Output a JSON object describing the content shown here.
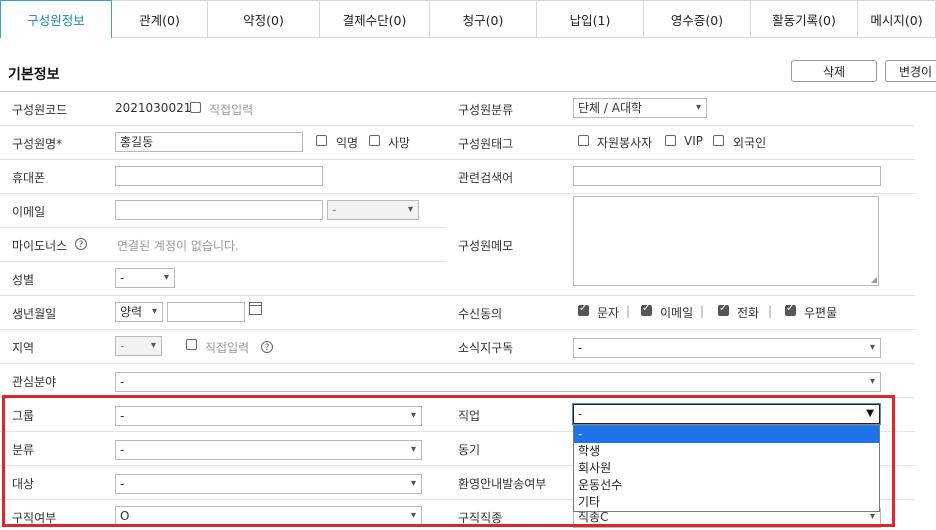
{
  "tabs": [
    {
      "label": "구성원정보",
      "active": true
    },
    {
      "label": "관계(0)"
    },
    {
      "label": "약정(0)"
    },
    {
      "label": "결제수단(0)"
    },
    {
      "label": "청구(0)"
    },
    {
      "label": "납입(1)"
    },
    {
      "label": "영수증(0)"
    },
    {
      "label": "활동기록(0)"
    },
    {
      "label": "메시지(0)"
    }
  ],
  "section_title": "기본정보",
  "buttons": {
    "delete": "삭제",
    "change": "변경이"
  },
  "left": {
    "code_label": "구성원코드",
    "code_value": "2021030021",
    "direct_input": "직접입력",
    "name_label": "구성원명*",
    "name_value": "홍길동",
    "anonymous": "익명",
    "deceased": "사망",
    "phone_label": "휴대폰",
    "email_label": "이메일",
    "email_domain": "-",
    "mind_label": "마이도너스",
    "mind_value": "연결된 계정이 없습니다.",
    "gender_label": "성별",
    "gender_value": "-",
    "birth_label": "생년월일",
    "birth_calendar": "양력",
    "region_label": "지역",
    "region_value": "-",
    "region_direct": "직접입력",
    "interest_label": "관심분야",
    "interest_value": "-",
    "group_label": "그룹",
    "group_value": "-",
    "class_label": "분류",
    "class_value": "-",
    "target_label": "대상",
    "target_value": "-",
    "job_label": "구직여부",
    "job_value": "O"
  },
  "right": {
    "category_label": "구성원분류",
    "category_value": "단체 / A대학",
    "tag_label": "구성원태그",
    "tags": [
      "자원봉사자",
      "VIP",
      "외국인"
    ],
    "keyword_label": "관련검색어",
    "memo_label": "구성원메모",
    "consent_label": "수신동의",
    "consents": [
      "문자",
      "이메일",
      "전화",
      "우편물"
    ],
    "news_label": "소식지구독",
    "news_value": "-",
    "occupation_label": "직업",
    "occupation_value": "-",
    "motive_label": "동기",
    "welcome_label": "환영안내발송여부",
    "job_type_label": "구직직종",
    "job_type_value": "직종C"
  },
  "occupation_options": [
    "-",
    "학생",
    "회사원",
    "운동선수",
    "기타"
  ],
  "colors": {
    "accent": "#1b8ca8",
    "highlight": "#e0262c",
    "selected": "#1e73e8"
  }
}
